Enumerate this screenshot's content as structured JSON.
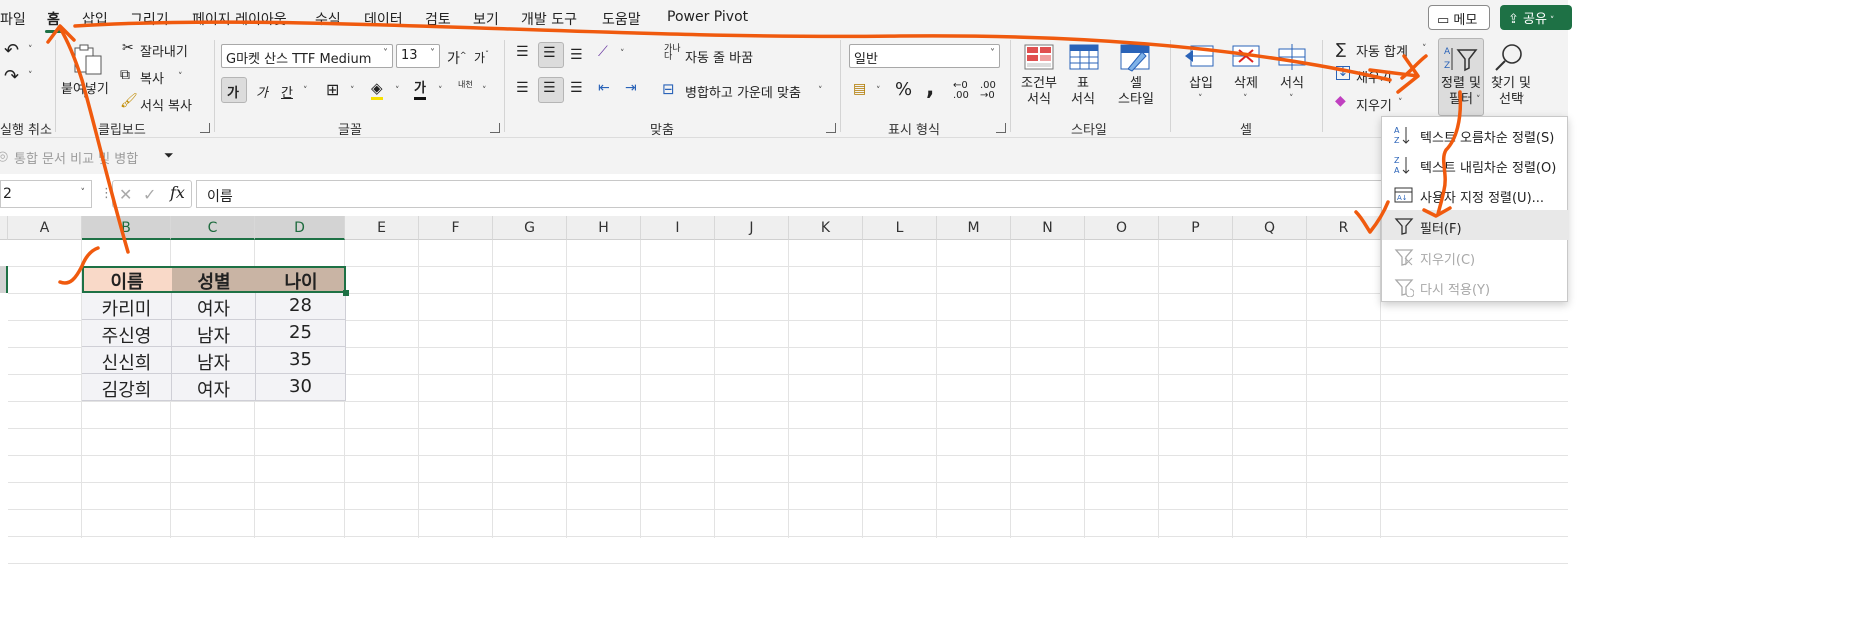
{
  "menu": {
    "tabs": [
      "파일",
      "홈",
      "삽입",
      "그리기",
      "페이지 레이아웃",
      "수식",
      "데이터",
      "검토",
      "보기",
      "개발 도구",
      "도움말",
      "Power Pivot"
    ],
    "active_tab": "홈",
    "memo_label": "메모",
    "share_label": "공유"
  },
  "ribbon": {
    "undo_group_label": "실행 취소",
    "clipboard": {
      "paste_label": "붙여넣기",
      "cut_label": "잘라내기",
      "copy_label": "복사",
      "format_painter_label": "서식 복사",
      "group_label": "클립보드"
    },
    "font": {
      "font_name": "G마켓 산스 TTF Medium",
      "font_size": "13",
      "grow_label": "가",
      "shrink_label": "가",
      "bold_label": "가",
      "italic_label": "가",
      "underline_label": "간",
      "color_label": "가",
      "phonetic_label": "내천",
      "group_label": "글꼴"
    },
    "alignment": {
      "wrap_label": "자동 줄 바꿈",
      "merge_label": "병합하고 가운데 맞춤",
      "group_label": "맞춤"
    },
    "number": {
      "format_value": "일반",
      "group_label": "표시 형식"
    },
    "styles": {
      "conditional_label": [
        "조건부",
        "서식"
      ],
      "table_label": [
        "표",
        "서식"
      ],
      "cell_style_label": [
        "셀",
        "스타일"
      ],
      "group_label": "스타일"
    },
    "cells": {
      "insert_label": "삽입",
      "delete_label": "삭제",
      "format_label": "서식",
      "group_label": "셀"
    },
    "editing": {
      "autosum_label": "자동 합계",
      "fill_label": "채우기",
      "clear_label": "지우기",
      "sort_filter_label": [
        "정렬 및",
        "필터"
      ],
      "find_select_label": [
        "찾기 및",
        "선택"
      ]
    }
  },
  "quick_access": {
    "compare_merge_label": "통합 문서 비교 및 병합"
  },
  "formula_bar": {
    "name_box": "2",
    "fx_label": "fx",
    "value": "이름"
  },
  "sheet": {
    "columns": [
      "A",
      "B",
      "C",
      "D",
      "E",
      "F",
      "G",
      "H",
      "I",
      "J",
      "K",
      "L",
      "M",
      "N",
      "O",
      "P",
      "Q",
      "R"
    ],
    "selected_columns": [
      "B",
      "C",
      "D"
    ],
    "table": {
      "headers": [
        "이름",
        "성별",
        "나이"
      ],
      "rows": [
        [
          "카리미",
          "여자",
          "28"
        ],
        [
          "주신영",
          "남자",
          "25"
        ],
        [
          "신신희",
          "남자",
          "35"
        ],
        [
          "김강희",
          "여자",
          "30"
        ]
      ],
      "header_colors": [
        "#f9d9c8",
        "#c9b4a4",
        "#c9b4a4"
      ]
    }
  },
  "sort_menu": {
    "items": [
      {
        "label": "텍스트 오름차순 정렬(S)",
        "enabled": true,
        "icon": "sort-ascending-icon"
      },
      {
        "label": "텍스트 내림차순 정렬(O)",
        "enabled": true,
        "icon": "sort-descending-icon"
      },
      {
        "label": "사용자 지정 정렬(U)...",
        "enabled": true,
        "icon": "custom-sort-icon"
      },
      {
        "label": "필터(F)",
        "enabled": true,
        "icon": "filter-icon"
      },
      {
        "label": "지우기(C)",
        "enabled": false,
        "icon": "clear-filter-icon"
      },
      {
        "label": "다시 적용(Y)",
        "enabled": false,
        "icon": "reapply-filter-icon"
      }
    ],
    "highlighted": "필터(F)"
  },
  "colors": {
    "accent_green": "#1e7145",
    "annotation_orange": "#f05a0e"
  }
}
